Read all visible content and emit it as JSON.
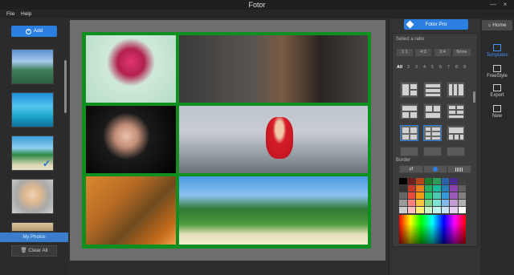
{
  "window": {
    "title": "Fotor",
    "minimize": "—",
    "close": "×"
  },
  "menu": [
    "File",
    "Help"
  ],
  "left_panel": {
    "add_label": "Add",
    "add_icon": "plus-circle-icon",
    "my_photos_label": "My Photos",
    "clear_all_label": "Clear All",
    "clear_icon": "trash-icon",
    "check_icon": "checkmark-icon"
  },
  "right_panel": {
    "pro_label": "Fotor Pro",
    "pro_icon": "diamond-icon",
    "ratio_label": "Select a ratio",
    "ratios": [
      "1:1",
      "4:3",
      "3:4",
      "None"
    ],
    "count_tabs": [
      "All",
      "2",
      "3",
      "4",
      "5",
      "6",
      "7",
      "8",
      "9"
    ],
    "active_count_tab": "All",
    "border_label": "Border",
    "border_icons": [
      "adjust-icon",
      "circle-icon",
      "pattern-icon"
    ],
    "accent": "#2b7fe0"
  },
  "nav": {
    "home_label": "Home",
    "items": [
      {
        "label": "Templates",
        "icon": "templates-icon",
        "active": true
      },
      {
        "label": "FreeStyle",
        "icon": "freestyle-icon",
        "active": false
      },
      {
        "label": "Export",
        "icon": "export-icon",
        "active": false
      },
      {
        "label": "New",
        "icon": "new-icon",
        "active": false
      }
    ]
  },
  "palette": [
    "#000000",
    "#6b1f1f",
    "#b4441a",
    "#1e7d2b",
    "#2e9b5c",
    "#2a62a8",
    "#4a2a8c",
    "#404040",
    "#333333",
    "#c0392b",
    "#e67e22",
    "#27ae60",
    "#1abc9c",
    "#2980b9",
    "#8e44ad",
    "#606060",
    "#666666",
    "#e74c3c",
    "#f39c12",
    "#2ecc71",
    "#48c9b0",
    "#3498db",
    "#9b59b6",
    "#808080",
    "#999999",
    "#ff7f7f",
    "#f5c542",
    "#7bd389",
    "#7fe3d4",
    "#7fb8ec",
    "#c39bd3",
    "#b0b0b0",
    "#cccccc",
    "#ffc0c0",
    "#fff176",
    "#c8f5c8",
    "#c0f5ee",
    "#c7e2f9",
    "#e5cdf0",
    "#ffffff"
  ]
}
